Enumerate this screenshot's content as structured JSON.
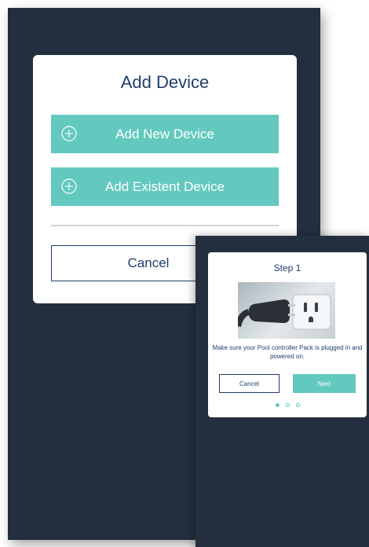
{
  "add_device_dialog": {
    "title": "Add Device",
    "add_new_label": "Add New Device",
    "add_existent_label": "Add Existent Device",
    "cancel_label": "Cancel"
  },
  "step_card": {
    "title": "Step 1",
    "image_icon": "power-plug-socket-icon",
    "message": "Make sure your Pool controller Pack is plugged in and powered on.",
    "cancel_label": "Cancel",
    "next_label": "Next",
    "steps": [
      {
        "active": true
      },
      {
        "active": false
      },
      {
        "active": false
      }
    ]
  },
  "colors": {
    "background_dark": "#232f3f",
    "accent_teal": "#63c9be",
    "text_navy": "#1f3d6b"
  }
}
